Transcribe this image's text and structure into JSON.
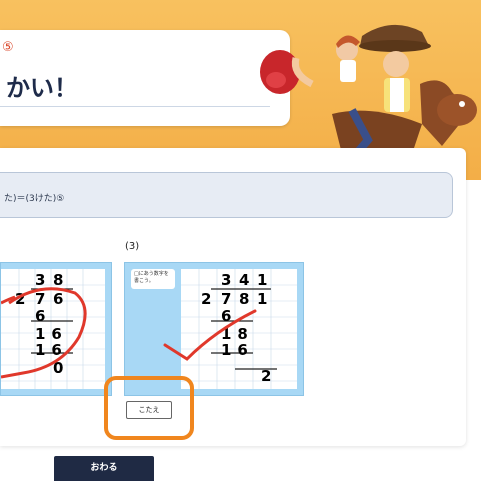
{
  "header": {
    "title_mark": "⑤",
    "title_text": "かい！"
  },
  "problem": {
    "text": "た)＝(3けた)⑤"
  },
  "question": {
    "label": "(3)",
    "hint": "□にあう数字を書こう。"
  },
  "left_card": {
    "quotient": [
      "3",
      "8"
    ],
    "divisor": "2",
    "dividend": [
      "7",
      "6"
    ],
    "steps": [
      "6",
      "16",
      "16",
      "0"
    ]
  },
  "right_card": {
    "quotient": [
      "3",
      "4",
      "1"
    ],
    "divisor": "2",
    "dividend": [
      "7",
      "8",
      "1"
    ],
    "steps": [
      "6",
      "18",
      "16",
      "2"
    ]
  },
  "buttons": {
    "answer_label": "こたえ",
    "finish_label": "おわる"
  },
  "colors": {
    "banner": "#f3ae47",
    "title_navy": "#1e2b4a",
    "card_blue": "#a8d8f5",
    "check_red": "#e0382b",
    "highlight_orange": "#f0861e",
    "finish_bg": "#1f2a44"
  }
}
